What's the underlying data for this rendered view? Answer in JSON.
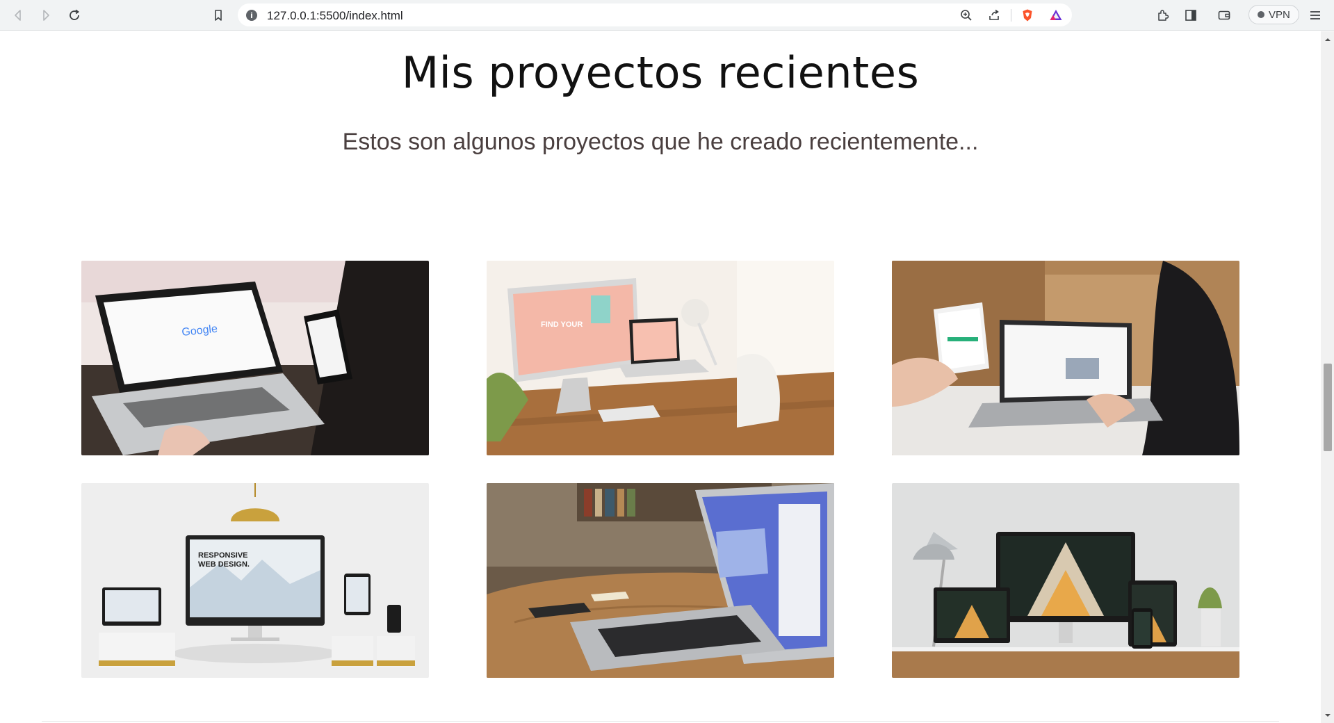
{
  "browser": {
    "url": "127.0.0.1:5500/index.html",
    "vpn_label": "VPN",
    "url_info_glyph": "i",
    "icons": {
      "back": "back-arrow-icon",
      "forward": "forward-arrow-icon",
      "reload": "reload-icon",
      "bookmark": "bookmark-icon",
      "zoom": "zoom-icon",
      "share": "share-icon",
      "brave": "brave-shield-icon",
      "rewards": "brave-rewards-icon",
      "extensions": "extensions-icon",
      "sidebar": "sidebar-icon",
      "wallet": "wallet-icon",
      "menu": "menu-icon"
    }
  },
  "page": {
    "title": "Mis proyectos recientes",
    "subtitle": "Estos son algunos proyectos que he creado recientemente..."
  },
  "projects": [
    {
      "image": "laptop-google-search-photo",
      "position_in_grid": "row 1, column 1"
    },
    {
      "image": "imac-desk-creativity-photo",
      "position_in_grid": "row 1, column 2"
    },
    {
      "image": "hands-phone-laptop-photo",
      "position_in_grid": "row 1, column 3"
    },
    {
      "image": "responsive-web-design-devices-photo",
      "position_in_grid": "row 2, column 1"
    },
    {
      "image": "macbook-wooden-table-photo",
      "position_in_grid": "row 2, column 2"
    },
    {
      "image": "architect-studio-devices-photo",
      "position_in_grid": "row 2, column 3"
    }
  ],
  "colors": {
    "title": "#111111",
    "subtitle": "#4a3f3f",
    "chrome_bg": "#f1f3f4",
    "brave_orange": "#fb542b"
  }
}
